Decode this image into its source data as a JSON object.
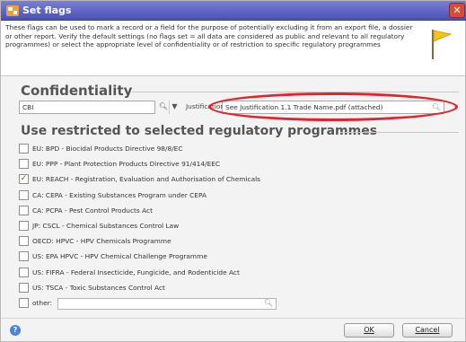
{
  "window": {
    "title": "Set flags",
    "close_glyph": "✕"
  },
  "intro": {
    "text": "These flags can be used to mark a record or a field for the purpose of potentially excluding it from an export file, a dossier or other report. Verify the default settings (no flags set = all data are considered as public and relevant to all regulatory programmes) or select the appropriate level of confidentiality or of restriction to specific regulatory programmes",
    "icon": "flag-icon"
  },
  "confidentiality": {
    "heading": "Confidentiality",
    "value": "CBI",
    "justification_label": "Justification",
    "justification_value": "See Justification 1.1 Trade Name.pdf (attached)"
  },
  "restricted": {
    "heading": "Use restricted to selected regulatory programmes",
    "items": [
      {
        "label": "EU: BPD - Biocidal Products Directive 98/8/EC",
        "checked": false
      },
      {
        "label": "EU: PPP - Plant Protection Products Directive 91/414/EEC",
        "checked": false
      },
      {
        "label": "EU: REACH - Registration, Evaluation and Authorisation of Chemicals",
        "checked": true
      },
      {
        "label": "CA: CEPA - Existing Substances Program under CEPA",
        "checked": false
      },
      {
        "label": "CA: PCPA - Pest Control Products Act",
        "checked": false
      },
      {
        "label": "JP: CSCL - Chemical Substances Control Law",
        "checked": false
      },
      {
        "label": "OECD: HPVC - HPV Chemicals Programme",
        "checked": false
      },
      {
        "label": "US: EPA HPVC - HPV Chemical Challenge Programme",
        "checked": false
      },
      {
        "label": "US: FIFRA - Federal Insecticide, Fungicide, and Rodenticide Act",
        "checked": false
      },
      {
        "label": "US: TSCA - Toxic Substances Control Act",
        "checked": false
      }
    ],
    "other_label": "other:",
    "other_value": ""
  },
  "footer": {
    "ok_label": "OK",
    "cancel_label": "Cancel"
  },
  "colors": {
    "title_bar": "#5a5fc8",
    "annotation_ellipse": "#e3222c",
    "checkmark": "#2a7a2a"
  }
}
